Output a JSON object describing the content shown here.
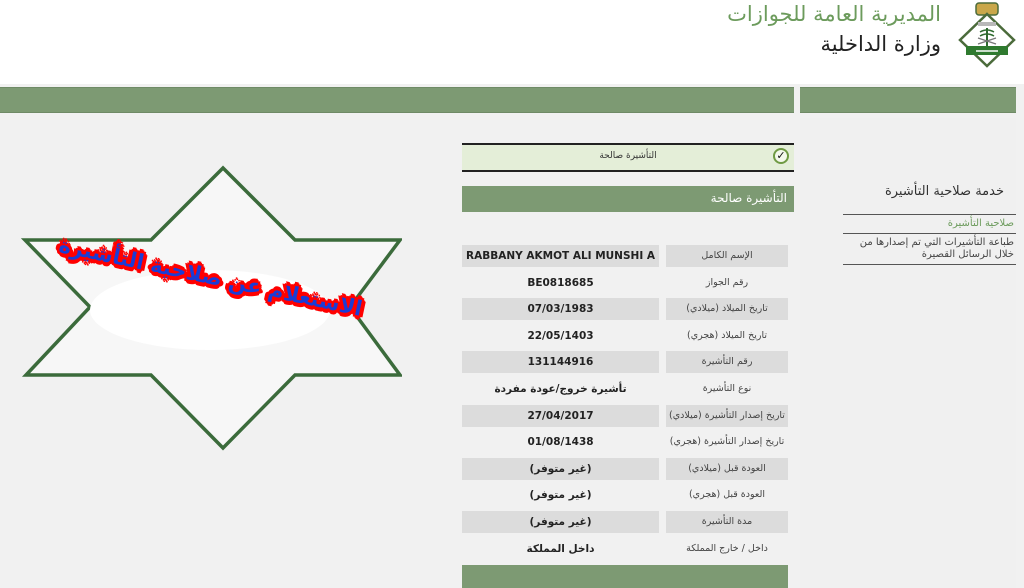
{
  "header": {
    "org_title": "المديرية العامة للجوازات",
    "ministry_title": "وزارة الداخلية",
    "logo_icon": "jawazat-emblem-icon"
  },
  "sidebar": {
    "title": "خدمة صلاحية التأشيرة",
    "items": [
      {
        "label": "صلاحية التأشيرة",
        "active": true
      },
      {
        "label": "طباعة التأشيرات التي تم إصدارها من خلال الرسائل القصيرة",
        "active": false
      }
    ]
  },
  "status": {
    "icon": "check-circle-icon",
    "text": "التأشيرة صالحة"
  },
  "section_title": "التأشيرة صالحة",
  "details": [
    {
      "label": "الإسم الكامل",
      "value": "RABBANY AKMOT ALI MUNSHI A"
    },
    {
      "label": "رقم الجواز",
      "value": "BE0818685"
    },
    {
      "label": "تاريخ الميلاد (ميلادي)",
      "value": "07/03/1983"
    },
    {
      "label": "تاريخ الميلاد (هجري)",
      "value": "22/05/1403"
    },
    {
      "label": "رقم التأشيرة",
      "value": "131144916"
    },
    {
      "label": "نوع التأشيرة",
      "value": "تأشيرة خروج/عودة مفردة"
    },
    {
      "label": "تاريخ إصدار التأشيرة (ميلادي)",
      "value": "27/04/2017"
    },
    {
      "label": "تاريخ إصدار التأشيرة (هجري)",
      "value": "01/08/1438"
    },
    {
      "label": "العودة قبل (ميلادي)",
      "value": "(غير متوفر)"
    },
    {
      "label": "العودة قبل (هجري)",
      "value": "(غير متوفر)"
    },
    {
      "label": "مدة التأشيرة",
      "value": "(غير متوفر)"
    },
    {
      "label": "داخل / خارج المملكة",
      "value": "داخل المملكة"
    }
  ],
  "overlay": {
    "caption": "الاستعلام عن صلاحية التأشيرة"
  },
  "colors": {
    "brand_green": "#7d9a73",
    "title_green": "#6c9b5c",
    "status_bg": "#e4eed8",
    "star_outline": "#3b6b3b",
    "caption_fill": "#1a3cd6",
    "caption_outline": "#ff0000"
  }
}
